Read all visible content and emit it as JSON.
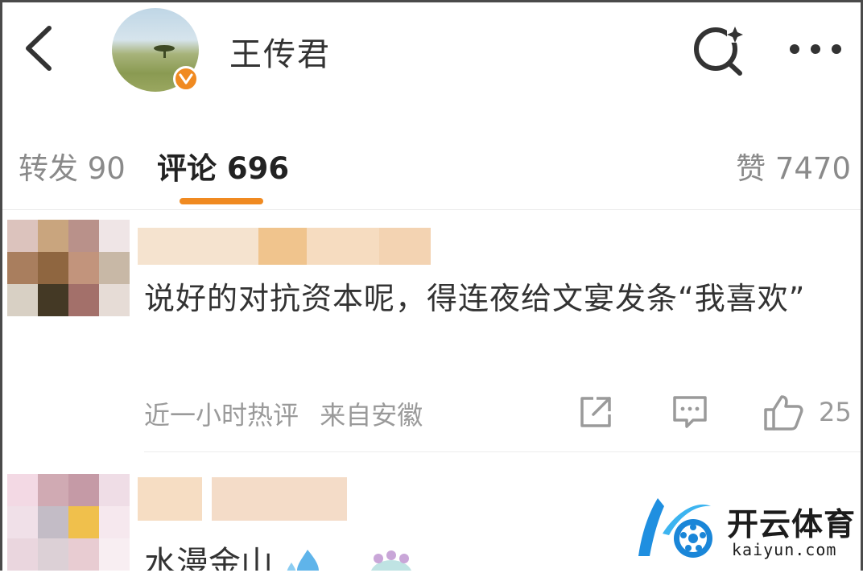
{
  "header": {
    "title": "王传君",
    "back_icon": "chevron-left-icon",
    "search_icon": "search-sparkle-icon",
    "more_icon": "more-horizontal-icon"
  },
  "tabs": {
    "repost": "转发 90",
    "comment": "评论 696",
    "like": "赞 7470",
    "active": "comment",
    "accent_color": "#f08a21"
  },
  "comments": [
    {
      "text": "说好的对抗资本呢，得连夜给文宴发条“我喜欢”",
      "time": "近一小时热评",
      "location": "来自安徽",
      "likes": "25"
    },
    {
      "text": "水漫金山"
    }
  ],
  "watermark": {
    "brand": "开云体育",
    "url": "kaiyun.com"
  }
}
